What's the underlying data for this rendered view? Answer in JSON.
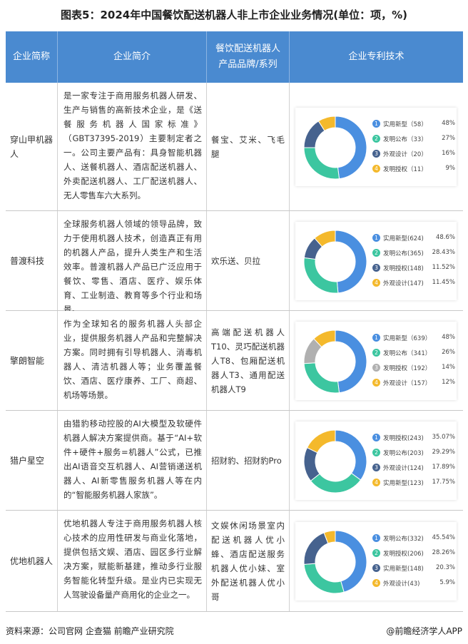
{
  "title": "图表5：2024年中国餐饮配送机器人非上市企业业务情况(单位：项，%)",
  "headers": {
    "name": "企业简称",
    "desc": "企业简介",
    "brand": "餐饮配送机器人产品品牌/系列",
    "patent": "企业专利技术"
  },
  "rows": [
    {
      "name": "穿山甲机器人",
      "desc": "是一家专注于商用服务机器人研发、生产与销售的高新技术企业，是《送餐服务机器人国家标准》（GBT37395-2019）主要制定者之一。公司主要产品有：具身智能机器人、送餐机器人、酒店配送机器人、外卖配送机器人、工厂配送机器人、无人零售车六大系列。",
      "brand": "餐宝、艾米、飞毛腿",
      "legend": [
        {
          "num": "1",
          "label": "实用新型（58）",
          "pct": "48%",
          "value": 48,
          "color": "#4a8fe0"
        },
        {
          "num": "2",
          "label": "发明公布（33）",
          "pct": "27%",
          "value": 27,
          "color": "#3cc6a0"
        },
        {
          "num": "3",
          "label": "外观设计（20）",
          "pct": "16%",
          "value": 16,
          "color": "#46628e"
        },
        {
          "num": "4",
          "label": "发明授权（11）",
          "pct": "9%",
          "value": 9,
          "color": "#f4b92c"
        }
      ]
    },
    {
      "name": "普渡科技",
      "desc": "全球服务机器人领域的领导品牌，致力于使用机器人技术，创造真正有用的机器人产品，提升人类生产和生活效率。普渡机器人产品已广泛应用于餐饮、零售、酒店、医疗、娱乐体育、工业制造、教育等多个行业和场景。",
      "brand": "欢乐送、贝拉",
      "legend": [
        {
          "num": "1",
          "label": "实用新型(624)",
          "pct": "48.6%",
          "value": 48.6,
          "color": "#4a8fe0"
        },
        {
          "num": "2",
          "label": "发明公布(365)",
          "pct": "28.43%",
          "value": 28.43,
          "color": "#3cc6a0"
        },
        {
          "num": "3",
          "label": "发明授权(148)",
          "pct": "11.52%",
          "value": 11.52,
          "color": "#46628e"
        },
        {
          "num": "4",
          "label": "外观设计(147)",
          "pct": "11.45%",
          "value": 11.45,
          "color": "#f4b92c"
        }
      ]
    },
    {
      "name": "擎朗智能",
      "desc": "作为全球知名的服务机器人头部企业，提供服务机器人产品和完整解决方案。同时拥有引导机器人、消毒机器人、清洁机器人等；业务覆盖餐饮、酒店、医疗康养、工厂、商超、机场等场景。",
      "brand": "高端配送机器人T10、灵巧配送机器人T8、包厢配送机器人T3、通用配送机器人T9",
      "legend": [
        {
          "num": "1",
          "label": "实用新型（639）",
          "pct": "48%",
          "value": 48,
          "color": "#4a8fe0"
        },
        {
          "num": "2",
          "label": "发明公布（341）",
          "pct": "26%",
          "value": 26,
          "color": "#3cc6a0"
        },
        {
          "num": "3",
          "label": "发明授权（192）",
          "pct": "14%",
          "value": 14,
          "color": "#b0b0b0"
        },
        {
          "num": "4",
          "label": "外观设计（157）",
          "pct": "12%",
          "value": 12,
          "color": "#f4b92c"
        }
      ]
    },
    {
      "name": "猎户星空",
      "desc": "由猎豹移动控股的AI大模型及软硬件机器人解决方案提供商。基于“AI+软件+硬件+服务=机器人”公式，已推出AI语音交互机器人、AI营销递送机器人、AI新零售服务机器人等在内的“智能服务机器人家族”。",
      "brand": "招财豹、招财豹Pro",
      "legend": [
        {
          "num": "1",
          "label": "发明授权(243)",
          "pct": "35.07%",
          "value": 35.07,
          "color": "#4a8fe0"
        },
        {
          "num": "2",
          "label": "发明公布(203)",
          "pct": "29.29%",
          "value": 29.29,
          "color": "#3cc6a0"
        },
        {
          "num": "3",
          "label": "外观设计(124)",
          "pct": "17.89%",
          "value": 17.89,
          "color": "#46628e"
        },
        {
          "num": "4",
          "label": "实用新型(123)",
          "pct": "17.75%",
          "value": 17.75,
          "color": "#f4b92c"
        }
      ]
    },
    {
      "name": "优地机器人",
      "desc": "优地机器人专注于商用服务机器人核心技术的应用性研发与商业化落地，提供包括文娱、酒店、园区多行业解决方案，赋能新基建，推动多行业服务智能化转型升级。是业内已实现无人驾驶设备量产商用化的企业之一。",
      "brand": "文娱休闲场景室内配送机器人优小蜂、酒店配送服务机器人优小妹、室外配送机器人优小哥",
      "legend": [
        {
          "num": "1",
          "label": "发明公布(332)",
          "pct": "45.54%",
          "value": 45.54,
          "color": "#4a8fe0"
        },
        {
          "num": "2",
          "label": "发明授权(206)",
          "pct": "28.26%",
          "value": 28.26,
          "color": "#3cc6a0"
        },
        {
          "num": "3",
          "label": "实用新型(148)",
          "pct": "20.3%",
          "value": 20.3,
          "color": "#46628e"
        },
        {
          "num": "4",
          "label": "外观设计(43)",
          "pct": "5.9%",
          "value": 5.9,
          "color": "#f4b92c"
        }
      ]
    }
  ],
  "footer": {
    "source": "资料来源：公司官网 企查猫 前瞻产业研究院",
    "app": "@前瞻经济学人APP"
  }
}
